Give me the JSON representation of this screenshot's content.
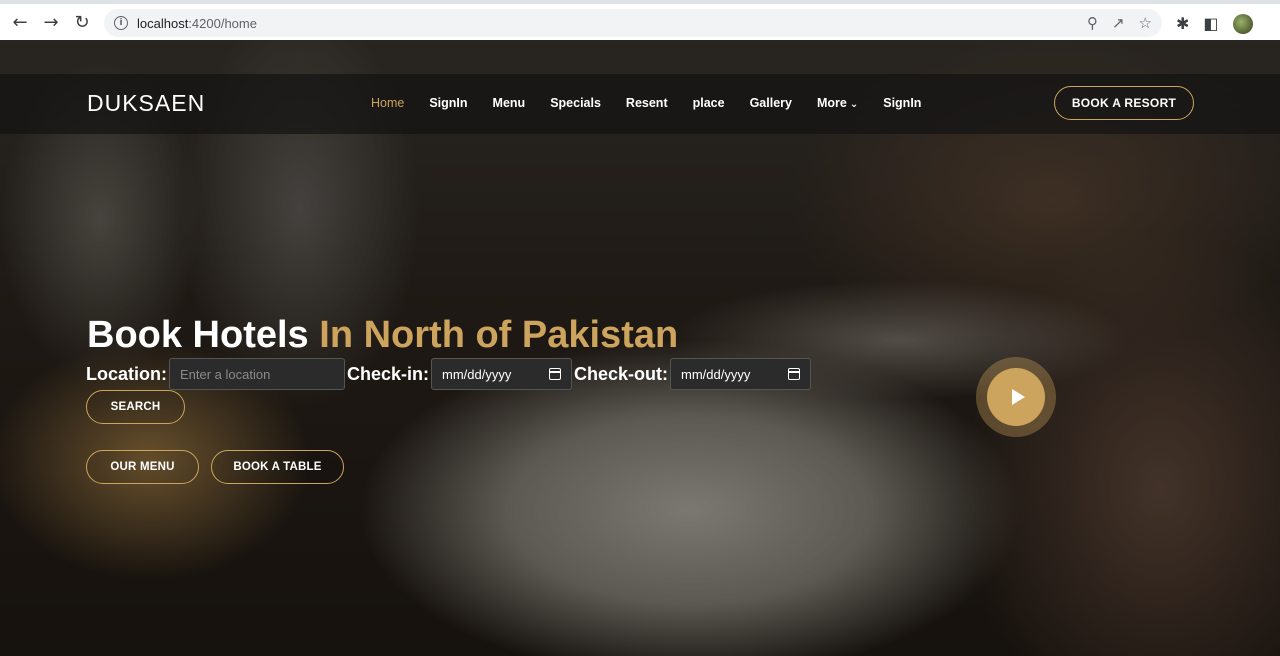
{
  "browser": {
    "url_host": "localhost",
    "url_path": ":4200/home"
  },
  "site": {
    "logo": "DUKSAEN",
    "nav": [
      "Home",
      "SignIn",
      "Menu",
      "Specials",
      "Resent",
      "place",
      "Gallery",
      "More",
      "SignIn"
    ],
    "active_nav": "Home",
    "book_resort": "BOOK A RESORT"
  },
  "hero": {
    "headline_main": "Book Hotels",
    "headline_accent": "In North of Pakistan",
    "location_label": "Location:",
    "location_placeholder": "Enter a location",
    "checkin_label": "Check-in:",
    "checkin_value": "mm/dd/yyyy",
    "checkout_label": "Check-out:",
    "checkout_value": "mm/dd/yyyy",
    "search_button": "SEARCH",
    "menu_button": "OUR MENU",
    "table_button": "BOOK A TABLE"
  },
  "colors": {
    "accent": "#cda45e",
    "header_bg": "#141414"
  },
  "icons": [
    "back-icon",
    "forward-icon",
    "reload-icon",
    "info-icon",
    "zoom-icon",
    "share-icon",
    "star-icon",
    "extensions-icon",
    "sidepanel-icon",
    "profile-avatar",
    "calendar-icon",
    "play-icon",
    "chevron-down-icon"
  ]
}
